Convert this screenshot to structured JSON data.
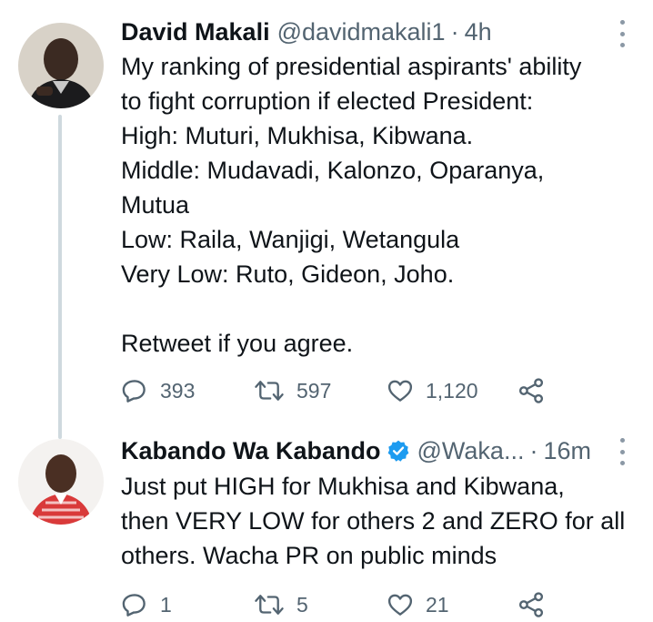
{
  "tweets": [
    {
      "author_name": "David Makali",
      "author_handle": "@davidmakali1",
      "time": "4h",
      "verified": false,
      "text": "My ranking of presidential aspirants' ability\nto fight corruption if elected President:\nHigh: Muturi, Mukhisa, Kibwana.\nMiddle: Mudavadi, Kalonzo, Oparanya,\nMutua\nLow: Raila, Wanjigi, Wetangula\nVery Low: Ruto, Gideon, Joho.\n\nRetweet if you agree.",
      "replies": "393",
      "retweets": "597",
      "likes": "1,120"
    },
    {
      "author_name": "Kabando Wa Kabando",
      "author_handle": "@Waka...",
      "time": "16m",
      "verified": true,
      "text": "Just put HIGH for Mukhisa and Kibwana,\nthen VERY LOW for others 2 and ZERO for all\nothers. Wacha PR on public minds",
      "replies": "1",
      "retweets": "5",
      "likes": "21"
    }
  ],
  "separator": "·",
  "icons": {
    "reply": "reply-icon",
    "retweet": "retweet-icon",
    "like": "heart-icon",
    "share": "share-icon",
    "more": "more-icon",
    "verified": "verified-badge-icon"
  },
  "colors": {
    "text": "#0f1419",
    "secondary": "#536471",
    "thread_line": "#cfd9de",
    "verified": "#1d9bf0"
  }
}
